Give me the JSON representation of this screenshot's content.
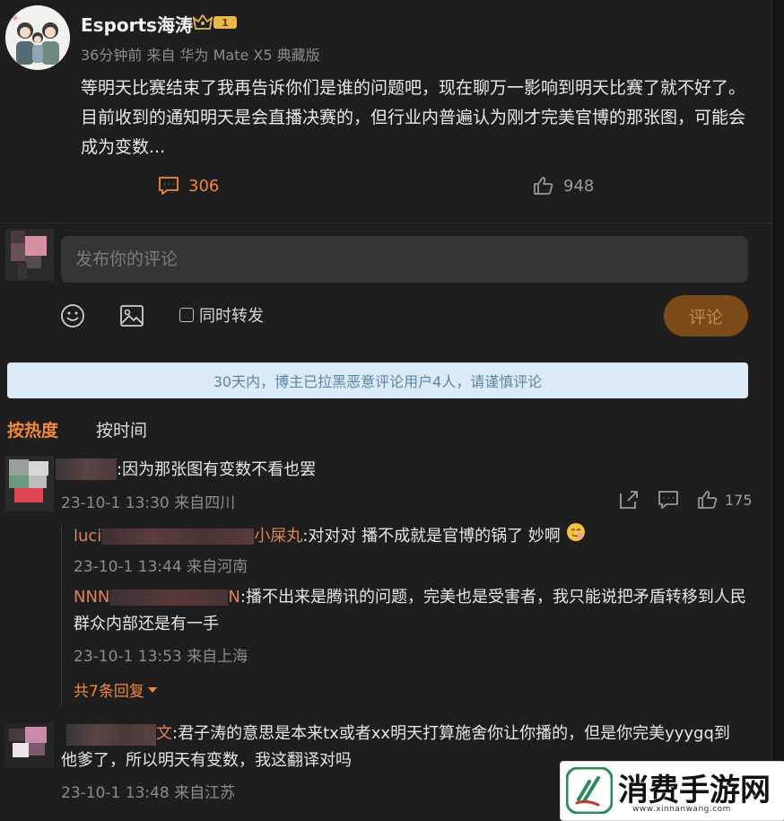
{
  "post": {
    "author": "Esports海涛",
    "badge_level": "1",
    "meta": "36分钟前 来自 华为 Mate X5 典藏版",
    "text": "等明天比赛结束了我再告诉你们是谁的问题吧，现在聊万一影响到明天比赛了就不好了。目前收到的通知明天是会直播决赛的，但行业内普遍认为刚才完美官博的那张图，可能会成为变数...",
    "comments_count": "306",
    "likes_count": "948"
  },
  "composer": {
    "placeholder": "发布你的评论",
    "repost_label": "同时转发",
    "submit_label": "评论",
    "icons": [
      "emoji-icon",
      "image-icon"
    ]
  },
  "notice": "30天内，博主已拉黑恶意评论用户4人，请谨慎评论",
  "sort": {
    "hot": "按热度",
    "time": "按时间"
  },
  "comments": [
    {
      "text": ":因为那张图有变数不看也罢",
      "meta": "23-10-1 13:30 来自四川",
      "likes": "175",
      "replies": [
        {
          "name": "luci",
          "name_tail": "小屎丸",
          "text": ":对对对 播不成就是官博的锅了 妙啊",
          "meta": "23-10-1 13:44 来自河南"
        },
        {
          "name": "NNN",
          "name_tail": "N",
          "text": ":播不出来是腾讯的问题，完美也是受害者，我只能说把矛盾转移到人民群众内部还是有一手",
          "meta": "23-10-1 13:53 来自上海"
        }
      ],
      "more_replies": "共7条回复"
    },
    {
      "name_tail": "文",
      "text": ":君子涛的意思是本来tx或者xx明天打算施舍你让你播的，但是你完美yyygq到他爹了，所以明天有变数，我这翻译对吗",
      "meta": "23-10-1 13:48 来自江苏"
    }
  ],
  "watermark": {
    "title": "消费手游网",
    "url": "www.xinnanwang.com"
  },
  "colors": {
    "accent": "#ef8a3c",
    "background": "#1e1e1e",
    "notice_bg": "#dbeaf6"
  }
}
